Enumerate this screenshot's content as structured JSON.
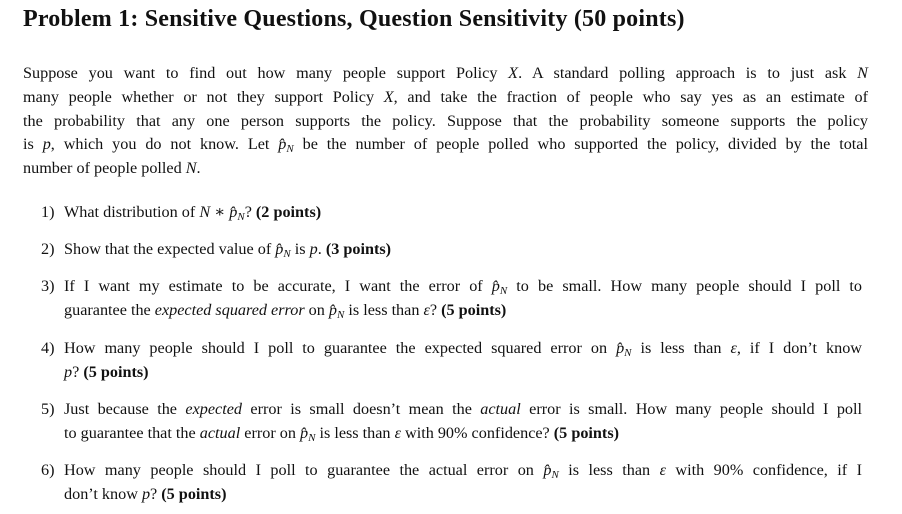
{
  "title": "Problem 1: Sensitive Questions, Question Sensitivity (50 points)",
  "intro": {
    "lines": [
      "Suppose you want to find out how many people support Policy X. A standard polling approach is to just ask N",
      "many people whether or not they support Policy X, and take the fraction of people who say yes as an estimate of",
      "the probability that any one person supports the policy. Suppose that the probability someone supports the policy",
      "is p, which you do not know. Let p̂N be the number of people polled who supported the policy, divided by the total",
      "number of people polled N."
    ]
  },
  "questions": [
    {
      "number": "1)",
      "lines": [
        "What distribution of N ∗ p̂N?"
      ],
      "points": "(2 points)"
    },
    {
      "number": "2)",
      "lines": [
        "Show that the expected value of p̂N is p."
      ],
      "points": "(3 points)"
    },
    {
      "number": "3)",
      "lines": [
        "If I want my estimate to be accurate, I want the error of p̂N to be small. How many people should I poll to",
        "guarantee the expected squared error on p̂N is less than ε?"
      ],
      "points": "(5 points)"
    },
    {
      "number": "4)",
      "lines": [
        "How many people should I poll to guarantee the expected squared error on p̂N is less than ε, if I don't know",
        "p?"
      ],
      "points": "(5 points)"
    },
    {
      "number": "5)",
      "lines": [
        "Just because the expected error is small doesn't mean the actual error is small. How many people should I poll",
        "to guarantee that the actual error on p̂N is less than ε with 90% confidence?"
      ],
      "points": "(5 points)"
    },
    {
      "number": "6)",
      "lines": [
        "How many people should I poll to guarantee the actual error on p̂N is less than ε with 90% confidence, if I",
        "don't know p?"
      ],
      "points": "(5 points)"
    }
  ]
}
